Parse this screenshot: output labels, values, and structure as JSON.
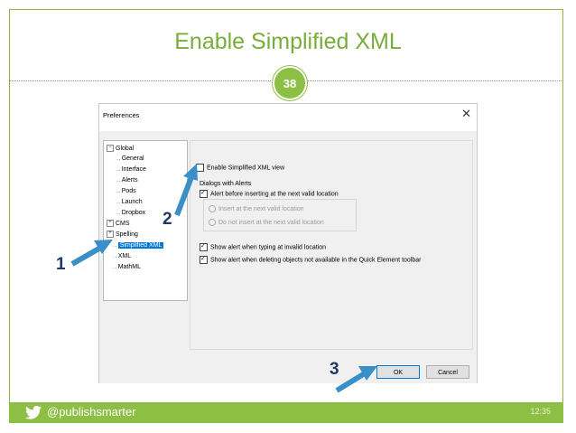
{
  "slide": {
    "title": "Enable Simplified XML",
    "number": "38",
    "handle": "@publishsmarter",
    "time": "12:35"
  },
  "dialog": {
    "title": "Preferences",
    "close_glyph": "✕",
    "tree": {
      "global": "Global",
      "general": "General",
      "interface": "Interface",
      "alerts": "Alerts",
      "pods": "Pods",
      "launch": "Launch",
      "dropbox": "Dropbox",
      "cms": "CMS",
      "spelling": "Spelling",
      "simplified_xml": "Simplified XML",
      "xml": "XML",
      "mathml": "MathML"
    },
    "options": {
      "enable_simplified": "Enable Simplified XML view",
      "dialogs_with_alerts": "Dialogs with Alerts",
      "alert_before_inserting": "Alert before inserting at the next valid location",
      "insert_next_valid": "Insert at the next valid location",
      "do_not_insert": "Do not insert at the next valid location",
      "show_alert_invalid": "Show alert when typing at invalid location",
      "show_alert_deleting": "Show alert when deleting objects not available in the Quick Element toolbar"
    },
    "state": {
      "enable_simplified": false,
      "alert_before_inserting": true,
      "show_alert_invalid": true,
      "show_alert_deleting": true
    },
    "buttons": {
      "ok": "OK",
      "cancel": "Cancel"
    }
  },
  "callouts": {
    "one": "1",
    "two": "2",
    "three": "3"
  },
  "colors": {
    "accent_green": "#8cbf44",
    "title_green": "#79ad3a",
    "callout_blue": "#1f3864",
    "arrow_blue": "#3a8fc7"
  },
  "icons": {
    "footer": "twitter-bird-icon",
    "close": "close-icon"
  }
}
